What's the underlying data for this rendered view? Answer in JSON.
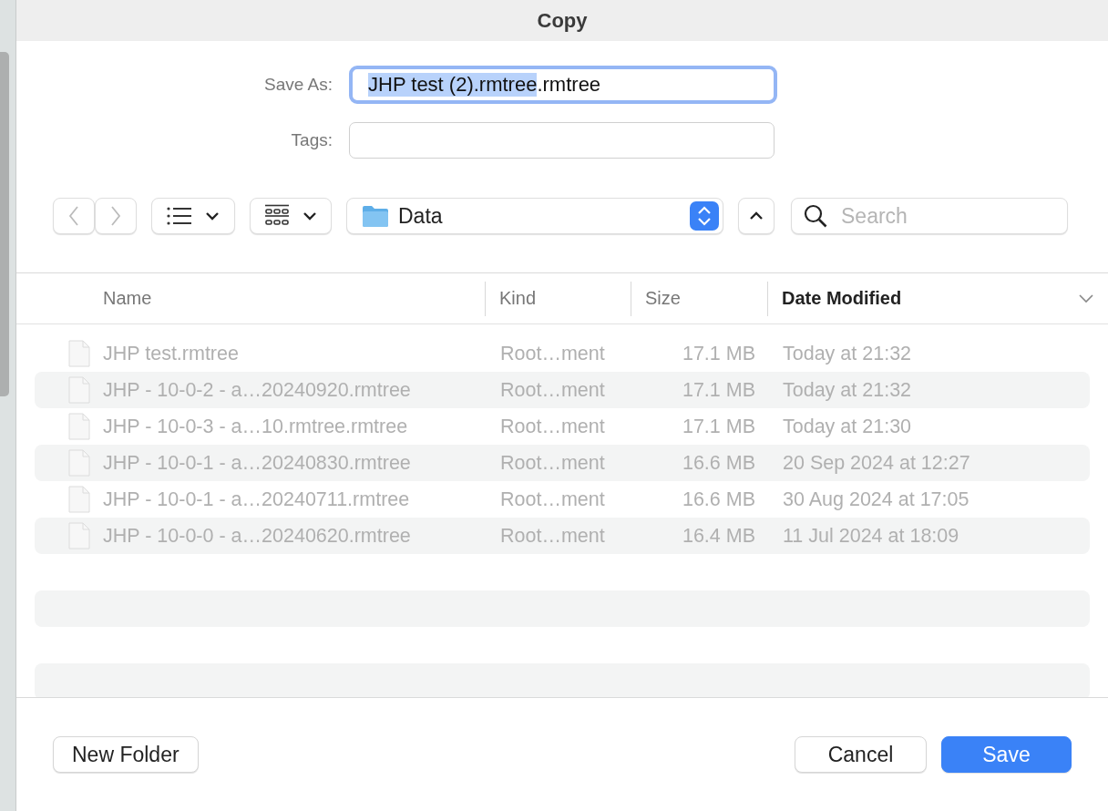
{
  "window": {
    "title": "Copy"
  },
  "save_as": {
    "label": "Save As:",
    "selected_text": "JHP test (2).rmtree",
    "unselected_text": ".rmtree"
  },
  "tags": {
    "label": "Tags:"
  },
  "toolbar": {
    "location": "Data",
    "search": {
      "placeholder": "Search"
    }
  },
  "table": {
    "columns": [
      {
        "label": "Name",
        "sorted": false
      },
      {
        "label": "Kind",
        "sorted": false
      },
      {
        "label": "Size",
        "sorted": false
      },
      {
        "label": "Date Modified",
        "sorted": true
      }
    ],
    "rows": [
      {
        "name": "JHP test.rmtree",
        "kind": "Root…ment",
        "size": "17.1 MB",
        "date": "Today at 21:32",
        "disabled": true
      },
      {
        "name": "JHP - 10-0-2 - a…20240920.rmtree",
        "kind": "Root…ment",
        "size": "17.1 MB",
        "date": "Today at 21:32",
        "disabled": true
      },
      {
        "name": "JHP - 10-0-3 - a…10.rmtree.rmtree",
        "kind": "Root…ment",
        "size": "17.1 MB",
        "date": "Today at 21:30",
        "disabled": true
      },
      {
        "name": "JHP - 10-0-1 - a…20240830.rmtree",
        "kind": "Root…ment",
        "size": "16.6 MB",
        "date": "20 Sep 2024 at 12:27",
        "disabled": true
      },
      {
        "name": "JHP - 10-0-1 - a…20240711.rmtree",
        "kind": "Root…ment",
        "size": "16.6 MB",
        "date": "30 Aug 2024 at 17:05",
        "disabled": true
      },
      {
        "name": "JHP - 10-0-0 - a…20240620.rmtree",
        "kind": "Root…ment",
        "size": "16.4 MB",
        "date": "11 Jul 2024 at 18:09",
        "disabled": true
      }
    ]
  },
  "buttons": [
    {
      "label": "New Folder",
      "kind": "secondary"
    },
    {
      "label": "Cancel",
      "kind": "secondary"
    },
    {
      "label": "Save",
      "kind": "default"
    }
  ]
}
